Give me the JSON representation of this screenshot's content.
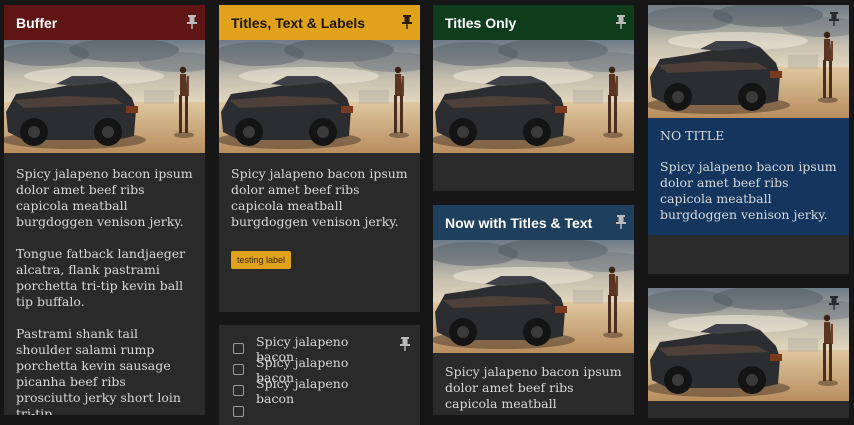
{
  "cards": {
    "buffer": {
      "title": "Buffer",
      "header_color": "#5e1513",
      "paragraphs": [
        "Spicy jalapeno bacon ipsum dolor amet beef ribs capicola meatball burgdoggen venison jerky.",
        "Tongue fatback landjaeger alcatra, flank pastrami porchetta tri-tip kevin ball tip buffalo.",
        "Pastrami shank tail shoulder salami rump porchetta kevin sausage picanha beef ribs prosciutto jerky short loin tri-tip."
      ]
    },
    "titles_text_labels": {
      "title": "Titles, Text & Labels",
      "header_color": "#e0a21b",
      "text": "Spicy jalapeno bacon ipsum dolor amet beef ribs capicola meatball burgdoggen venison jerky.",
      "label": "testing label"
    },
    "checklist": {
      "items": [
        "Spicy jalapeno bacon",
        "Spicy jalapeno bacon",
        "Spicy jalapeno bacon"
      ]
    },
    "titles_only": {
      "title": "Titles Only",
      "header_color": "#0f3d1c"
    },
    "titles_and_text": {
      "title": "Now with Titles & Text",
      "header_color": "#1f3f5e",
      "text": "Spicy jalapeno bacon ipsum dolor amet beef ribs capicola meatball burgdoggen venison"
    },
    "no_title": {
      "heading": "NO TITLE",
      "text": "Spicy jalapeno bacon ipsum dolor amet beef ribs capicola meatball burgdoggen venison jerky.",
      "block_color": "#13355e"
    },
    "image_only": {}
  },
  "icons": {
    "pin": "pin-icon",
    "photo": "car-and-woman-photo"
  }
}
